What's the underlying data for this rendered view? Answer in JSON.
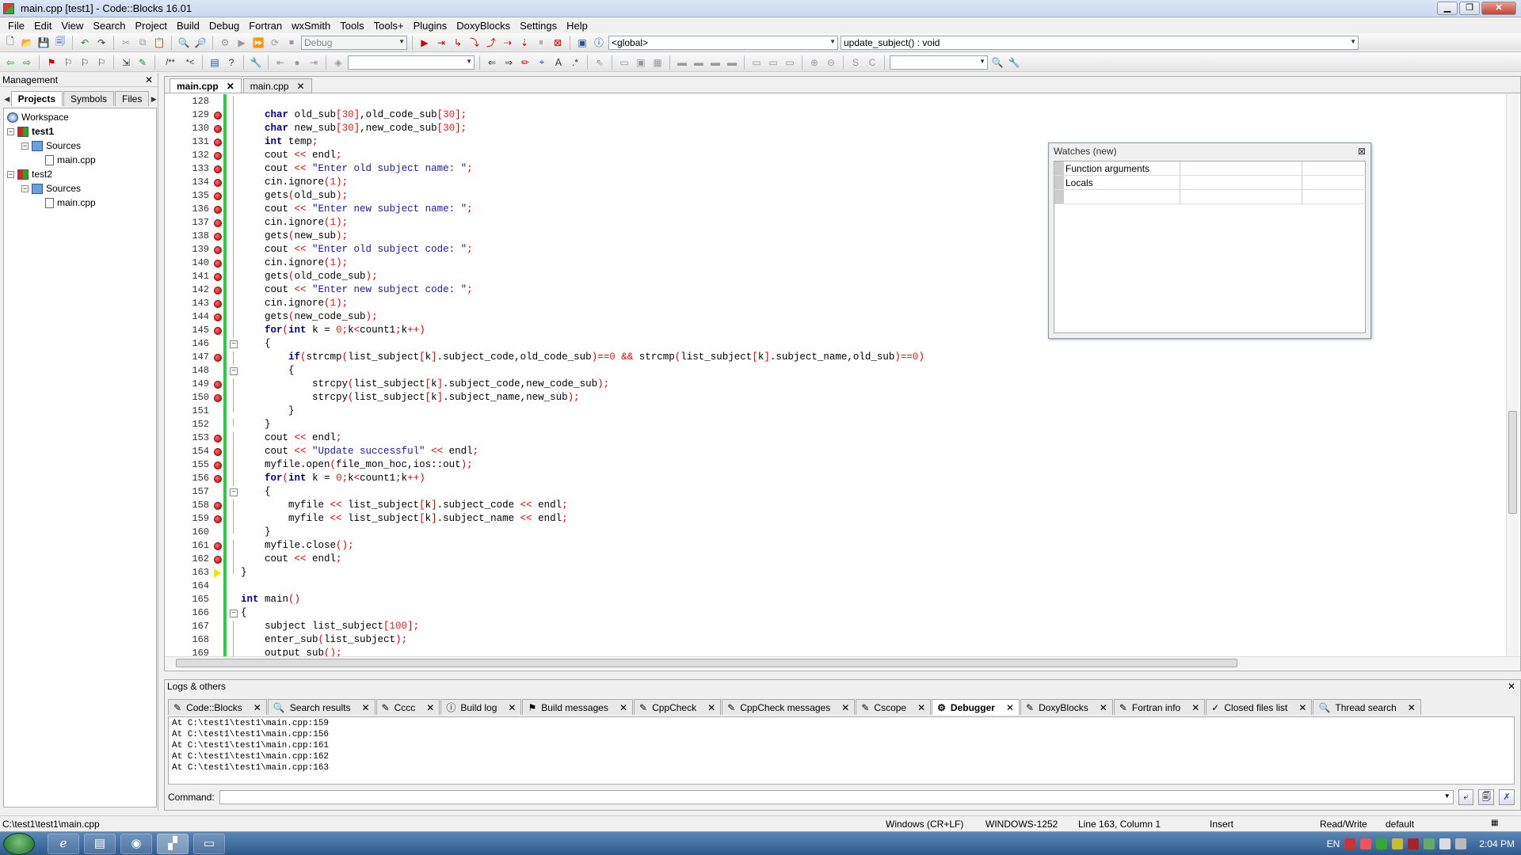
{
  "window": {
    "title": "main.cpp [test1] - Code::Blocks 16.01"
  },
  "menu": [
    "File",
    "Edit",
    "View",
    "Search",
    "Project",
    "Build",
    "Debug",
    "Fortran",
    "wxSmith",
    "Tools",
    "Tools+",
    "Plugins",
    "DoxyBlocks",
    "Settings",
    "Help"
  ],
  "toolbar": {
    "build_target": "Debug",
    "scope": "<global>",
    "function": "update_subject() : void"
  },
  "management": {
    "title": "Management",
    "tabs": [
      "Projects",
      "Symbols",
      "Files"
    ],
    "tree": {
      "workspace": "Workspace",
      "projects": [
        {
          "name": "test1",
          "folder": "Sources",
          "file": "main.cpp"
        },
        {
          "name": "test2",
          "folder": "Sources",
          "file": "main.cpp"
        }
      ]
    }
  },
  "editor": {
    "tabs": [
      {
        "label": "main.cpp",
        "active": true
      },
      {
        "label": "main.cpp",
        "active": false
      }
    ],
    "current_line": 163,
    "lines": [
      {
        "n": 128,
        "bp": false,
        "fold": "line",
        "code": ""
      },
      {
        "n": 129,
        "bp": true,
        "fold": "line",
        "code": "    char old_sub[30],old_code_sub[30];"
      },
      {
        "n": 130,
        "bp": true,
        "fold": "line",
        "code": "    char new_sub[30],new_code_sub[30];"
      },
      {
        "n": 131,
        "bp": true,
        "fold": "line",
        "code": "    int temp;"
      },
      {
        "n": 132,
        "bp": true,
        "fold": "line",
        "code": "    cout << endl;"
      },
      {
        "n": 133,
        "bp": true,
        "fold": "line",
        "code": "    cout << \"Enter old subject name: \";"
      },
      {
        "n": 134,
        "bp": true,
        "fold": "line",
        "code": "    cin.ignore(1);"
      },
      {
        "n": 135,
        "bp": true,
        "fold": "line",
        "code": "    gets(old_sub);"
      },
      {
        "n": 136,
        "bp": true,
        "fold": "line",
        "code": "    cout << \"Enter new subject name: \";"
      },
      {
        "n": 137,
        "bp": true,
        "fold": "line",
        "code": "    cin.ignore(1);"
      },
      {
        "n": 138,
        "bp": true,
        "fold": "line",
        "code": "    gets(new_sub);"
      },
      {
        "n": 139,
        "bp": true,
        "fold": "line",
        "code": "    cout << \"Enter old subject code: \";"
      },
      {
        "n": 140,
        "bp": true,
        "fold": "line",
        "code": "    cin.ignore(1);"
      },
      {
        "n": 141,
        "bp": true,
        "fold": "line",
        "code": "    gets(old_code_sub);"
      },
      {
        "n": 142,
        "bp": true,
        "fold": "line",
        "code": "    cout << \"Enter new subject code: \";"
      },
      {
        "n": 143,
        "bp": true,
        "fold": "line",
        "code": "    cin.ignore(1);"
      },
      {
        "n": 144,
        "bp": true,
        "fold": "line",
        "code": "    gets(new_code_sub);"
      },
      {
        "n": 145,
        "bp": true,
        "fold": "line",
        "code": "    for(int k = 0;k<count1;k++)"
      },
      {
        "n": 146,
        "bp": false,
        "fold": "box",
        "code": "    {"
      },
      {
        "n": 147,
        "bp": true,
        "fold": "line",
        "code": "        if(strcmp(list_subject[k].subject_code,old_code_sub)==0 && strcmp(list_subject[k].subject_name,old_sub)==0)"
      },
      {
        "n": 148,
        "bp": false,
        "fold": "box",
        "code": "        {"
      },
      {
        "n": 149,
        "bp": true,
        "fold": "line",
        "code": "            strcpy(list_subject[k].subject_code,new_code_sub);"
      },
      {
        "n": 150,
        "bp": true,
        "fold": "line",
        "code": "            strcpy(list_subject[k].subject_name,new_sub);"
      },
      {
        "n": 151,
        "bp": false,
        "fold": "end",
        "code": "        }"
      },
      {
        "n": 152,
        "bp": false,
        "fold": "end",
        "code": "    }"
      },
      {
        "n": 153,
        "bp": true,
        "fold": "line",
        "code": "    cout << endl;"
      },
      {
        "n": 154,
        "bp": true,
        "fold": "line",
        "code": "    cout << \"Update successful\" << endl;"
      },
      {
        "n": 155,
        "bp": true,
        "fold": "line",
        "code": "    myfile.open(file_mon_hoc,ios::out);"
      },
      {
        "n": 156,
        "bp": true,
        "fold": "line",
        "code": "    for(int k = 0;k<count1;k++)"
      },
      {
        "n": 157,
        "bp": false,
        "fold": "box",
        "code": "    {"
      },
      {
        "n": 158,
        "bp": true,
        "fold": "line",
        "code": "        myfile << list_subject[k].subject_code << endl;"
      },
      {
        "n": 159,
        "bp": true,
        "fold": "line",
        "code": "        myfile << list_subject[k].subject_name << endl;"
      },
      {
        "n": 160,
        "bp": false,
        "fold": "end",
        "code": "    }"
      },
      {
        "n": 161,
        "bp": true,
        "fold": "line",
        "code": "    myfile.close();"
      },
      {
        "n": 162,
        "bp": true,
        "fold": "line",
        "code": "    cout << endl;"
      },
      {
        "n": 163,
        "bp": false,
        "fold": "end",
        "code": "}"
      },
      {
        "n": 164,
        "bp": false,
        "fold": "none",
        "code": ""
      },
      {
        "n": 165,
        "bp": false,
        "fold": "none",
        "code": "int main()"
      },
      {
        "n": 166,
        "bp": false,
        "fold": "box",
        "code": "{"
      },
      {
        "n": 167,
        "bp": false,
        "fold": "line",
        "code": "    subject list_subject[100];"
      },
      {
        "n": 168,
        "bp": false,
        "fold": "line",
        "code": "    enter_sub(list_subject);"
      },
      {
        "n": 169,
        "bp": false,
        "fold": "line",
        "code": "    output_sub();"
      }
    ]
  },
  "watches": {
    "title": "Watches (new)",
    "rows": [
      "Function arguments",
      "Locals",
      ""
    ]
  },
  "logs": {
    "title": "Logs & others",
    "tabs": [
      "Code::Blocks",
      "Search results",
      "Cccc",
      "Build log",
      "Build messages",
      "CppCheck",
      "CppCheck messages",
      "Cscope",
      "Debugger",
      "DoxyBlocks",
      "Fortran info",
      "Closed files list",
      "Thread search"
    ],
    "active_tab": "Debugger",
    "lines": [
      "At C:\\test1\\test1\\main.cpp:159",
      "At C:\\test1\\test1\\main.cpp:156",
      "At C:\\test1\\test1\\main.cpp:161",
      "At C:\\test1\\test1\\main.cpp:162",
      "At C:\\test1\\test1\\main.cpp:163"
    ],
    "command_label": "Command:"
  },
  "status": {
    "path": "C:\\test1\\test1\\main.cpp",
    "eol": "Windows (CR+LF)",
    "encoding": "WINDOWS-1252",
    "position": "Line 163, Column 1",
    "mode": "Insert",
    "access": "Read/Write",
    "profile": "default"
  },
  "taskbar": {
    "lang": "EN",
    "clock": "2:04 PM"
  }
}
